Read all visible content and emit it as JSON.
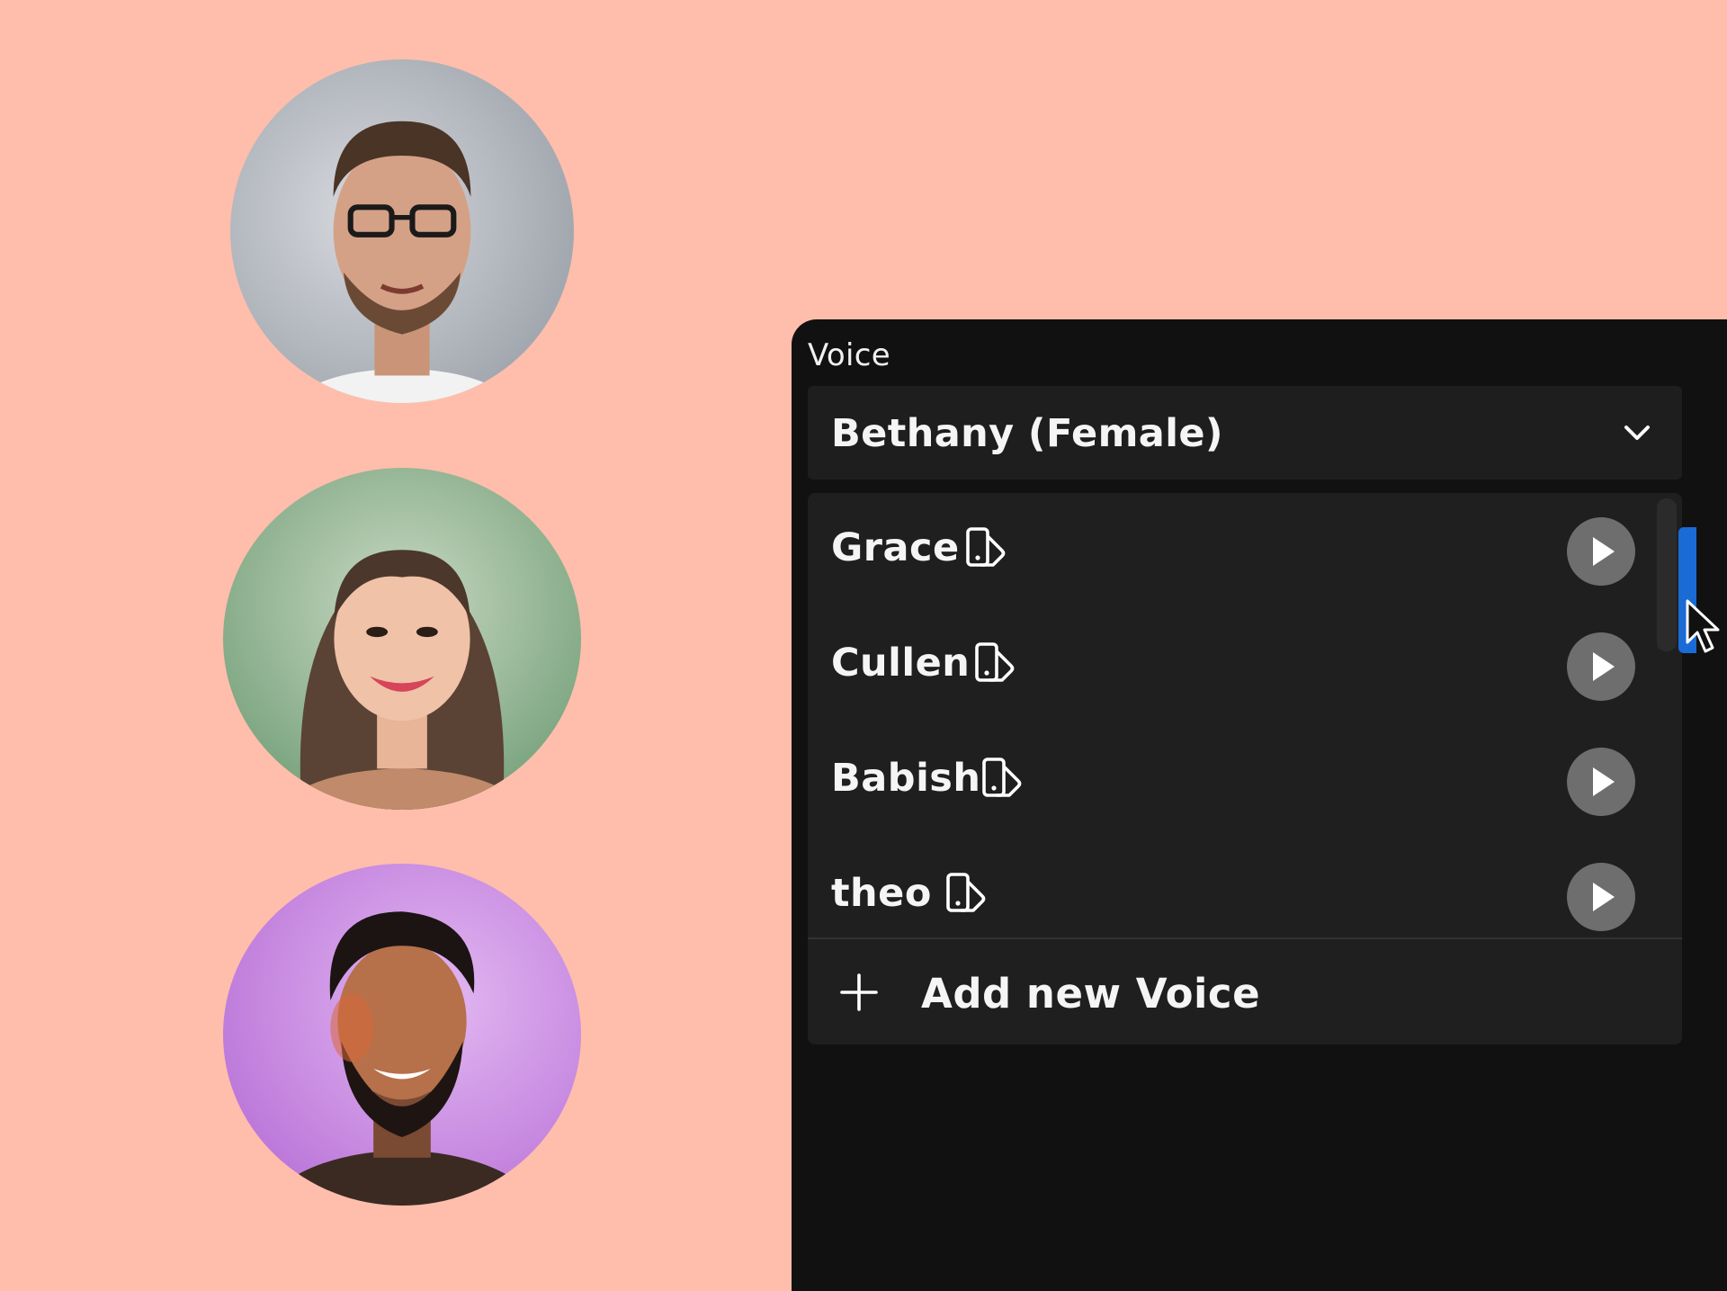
{
  "colors": {
    "background": "#ffbeab",
    "panel": "#111111",
    "surface": "#1f1f1f",
    "play_button": "#6e6e6e",
    "text": "#f5f5f5",
    "accent": "#1a6bd6"
  },
  "avatars": [
    {
      "name": "avatar",
      "icon": "person-photo"
    },
    {
      "name": "avatar",
      "icon": "person-photo"
    },
    {
      "name": "avatar",
      "icon": "person-photo"
    }
  ],
  "voice_panel": {
    "label": "Voice",
    "selected_value": "Bethany (Female)",
    "dropdown_icon": "chevron-down-icon",
    "options": [
      {
        "name": "Grace",
        "icon": "voice-clone-icon",
        "action_icon": "play-icon"
      },
      {
        "name": "Cullen",
        "icon": "voice-clone-icon",
        "action_icon": "play-icon"
      },
      {
        "name": "Babish",
        "icon": "voice-clone-icon",
        "action_icon": "play-icon"
      },
      {
        "name": "theo",
        "icon": "voice-clone-icon",
        "action_icon": "play-icon"
      }
    ],
    "add_action": {
      "icon": "plus-icon",
      "label": "Add new Voice"
    }
  }
}
